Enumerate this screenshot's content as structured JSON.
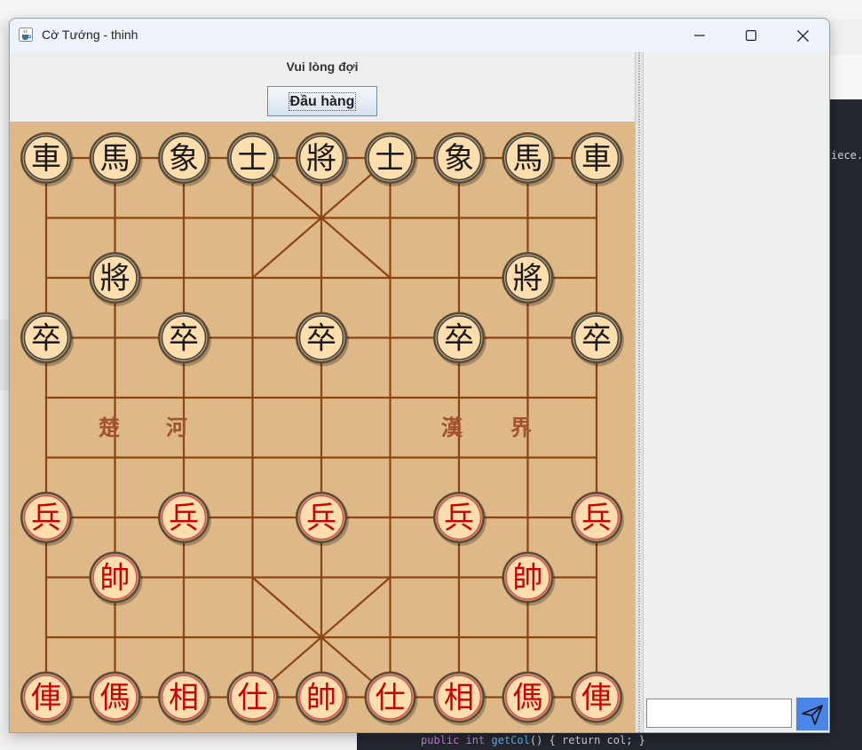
{
  "window": {
    "title": "Cờ Tướng - thinh",
    "icon": "java-cup-icon",
    "controls": [
      "minimize-icon",
      "maximize-icon",
      "close-icon"
    ]
  },
  "game": {
    "status": "Vui lòng đợi",
    "surrender_label": "Đầu hàng"
  },
  "board": {
    "river_labels": [
      "楚",
      "河",
      "漢",
      "界"
    ],
    "colors": {
      "background": "#deb887",
      "lines": "#8b4513",
      "river_text": "#a0522d",
      "piece_fill": "#ffdead",
      "black_text": "#1a1a1a",
      "red_text": "#cc0000",
      "red_ring": "#e05050"
    },
    "pieces": [
      {
        "c": 0,
        "r": 0,
        "ch": "車",
        "side": "black"
      },
      {
        "c": 1,
        "r": 0,
        "ch": "馬",
        "side": "black"
      },
      {
        "c": 2,
        "r": 0,
        "ch": "象",
        "side": "black"
      },
      {
        "c": 3,
        "r": 0,
        "ch": "士",
        "side": "black"
      },
      {
        "c": 4,
        "r": 0,
        "ch": "將",
        "side": "black"
      },
      {
        "c": 5,
        "r": 0,
        "ch": "士",
        "side": "black"
      },
      {
        "c": 6,
        "r": 0,
        "ch": "象",
        "side": "black"
      },
      {
        "c": 7,
        "r": 0,
        "ch": "馬",
        "side": "black"
      },
      {
        "c": 8,
        "r": 0,
        "ch": "車",
        "side": "black"
      },
      {
        "c": 1,
        "r": 2,
        "ch": "將",
        "side": "black"
      },
      {
        "c": 7,
        "r": 2,
        "ch": "將",
        "side": "black"
      },
      {
        "c": 0,
        "r": 3,
        "ch": "卒",
        "side": "black"
      },
      {
        "c": 2,
        "r": 3,
        "ch": "卒",
        "side": "black"
      },
      {
        "c": 4,
        "r": 3,
        "ch": "卒",
        "side": "black"
      },
      {
        "c": 6,
        "r": 3,
        "ch": "卒",
        "side": "black"
      },
      {
        "c": 8,
        "r": 3,
        "ch": "卒",
        "side": "black"
      },
      {
        "c": 0,
        "r": 6,
        "ch": "兵",
        "side": "red"
      },
      {
        "c": 2,
        "r": 6,
        "ch": "兵",
        "side": "red"
      },
      {
        "c": 4,
        "r": 6,
        "ch": "兵",
        "side": "red"
      },
      {
        "c": 6,
        "r": 6,
        "ch": "兵",
        "side": "red"
      },
      {
        "c": 8,
        "r": 6,
        "ch": "兵",
        "side": "red"
      },
      {
        "c": 1,
        "r": 7,
        "ch": "帥",
        "side": "red"
      },
      {
        "c": 7,
        "r": 7,
        "ch": "帥",
        "side": "red"
      },
      {
        "c": 0,
        "r": 9,
        "ch": "俥",
        "side": "red"
      },
      {
        "c": 1,
        "r": 9,
        "ch": "傌",
        "side": "red"
      },
      {
        "c": 2,
        "r": 9,
        "ch": "相",
        "side": "red"
      },
      {
        "c": 3,
        "r": 9,
        "ch": "仕",
        "side": "red"
      },
      {
        "c": 4,
        "r": 9,
        "ch": "帥",
        "side": "red"
      },
      {
        "c": 5,
        "r": 9,
        "ch": "仕",
        "side": "red"
      },
      {
        "c": 6,
        "r": 9,
        "ch": "相",
        "side": "red"
      },
      {
        "c": 7,
        "r": 9,
        "ch": "傌",
        "side": "red"
      },
      {
        "c": 8,
        "r": 9,
        "ch": "俥",
        "side": "red"
      }
    ]
  },
  "chat": {
    "input_value": "",
    "send_icon": "send-paper-plane-icon",
    "send_color": "#4a86e8"
  },
  "background": {
    "ide_text": "iece.",
    "ide_code_kw": "public int",
    "ide_code_fn": "getCol",
    "ide_code_rest": "() { return col; }"
  }
}
